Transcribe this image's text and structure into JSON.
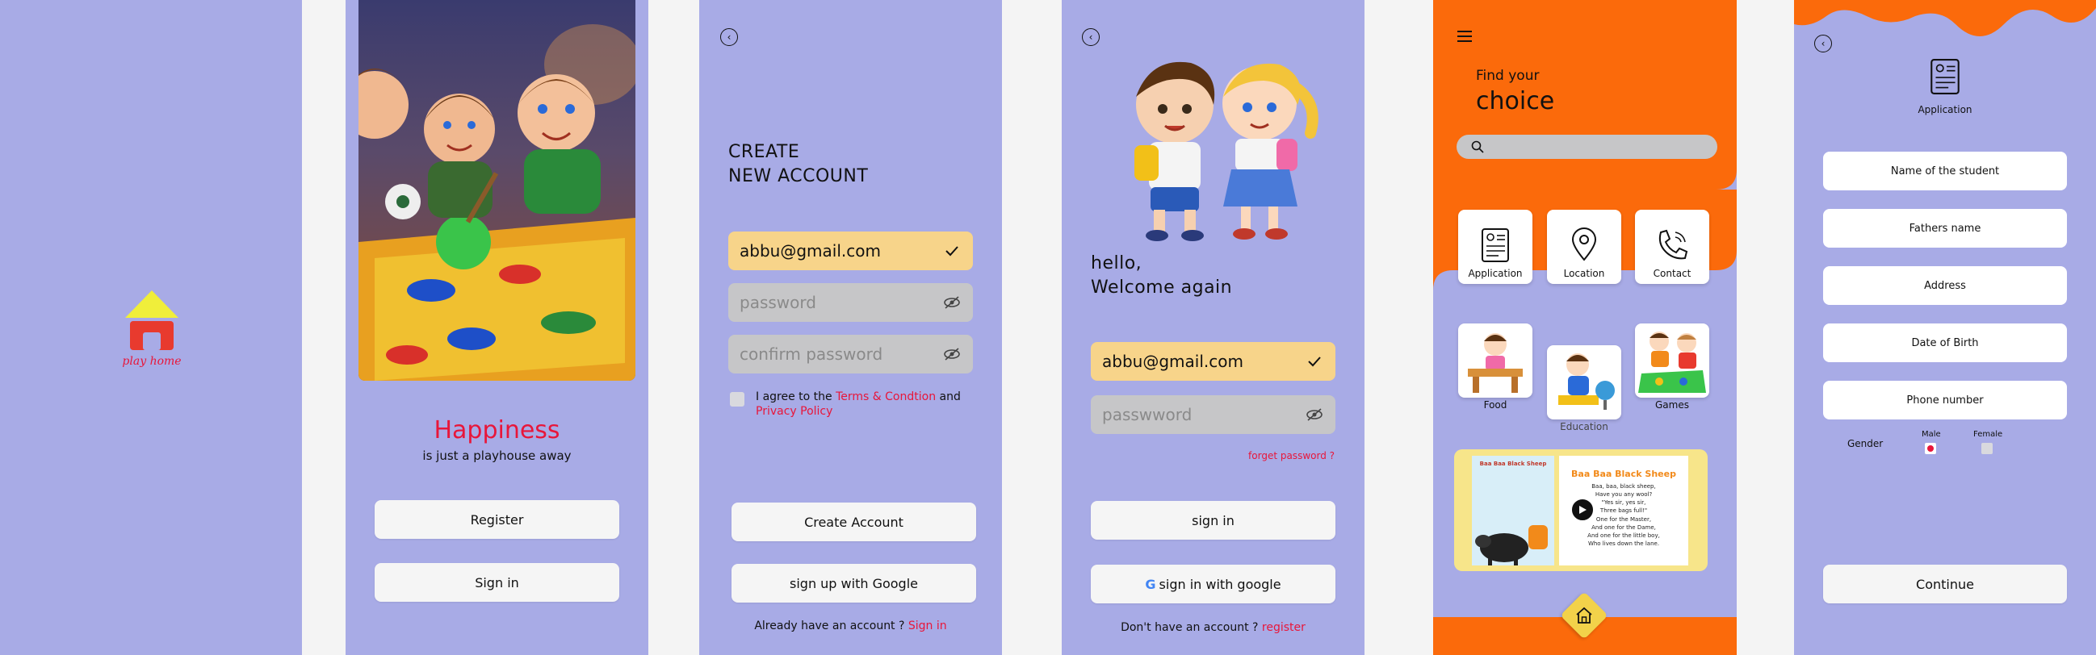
{
  "colors": {
    "lavender": "#a8abe6",
    "orange": "#fb6a0b",
    "yellow": "#f7d48a",
    "red": "#e8163a",
    "gray_field": "#c6c6c8",
    "logo_yellow": "#f0ee3a",
    "logo_red": "#e83a2e"
  },
  "splash": {
    "logo_text": "play home",
    "icon": "house-logo-icon"
  },
  "welcome": {
    "title": "Happiness",
    "subtitle": "is just a playhouse away",
    "register_label": "Register",
    "signin_label": "Sign in",
    "image": "kids-playing-board-game"
  },
  "create_account": {
    "heading_line1": "CREATE",
    "heading_line2": "NEW ACCOUNT",
    "email_value": "abbu@gmail.com",
    "password_placeholder": "password",
    "confirm_placeholder": "confirm password",
    "agree_text": "I agree to the ",
    "terms_link": "Terms & Condtion",
    "and_text": " and",
    "privacy_link": "Privacy Policy",
    "create_button": "Create Account",
    "google_button": "sign up with Google",
    "have_account_text": "Already have an account ? ",
    "signin_link": "Sign in"
  },
  "login": {
    "greeting_line1": "hello,",
    "greeting_line2": "Welcome again",
    "email_value": "abbu@gmail.com",
    "password_placeholder": "passwword",
    "forget_link": "forget password ?",
    "signin_button": "sign in",
    "google_button": "sign in with google",
    "no_account_text": "Don't have an account ? ",
    "register_link": "register",
    "image": "two-kids-with-backpacks"
  },
  "home": {
    "find_text": "Find your",
    "choice_text": "choice",
    "search_placeholder": "",
    "menu_cards": [
      {
        "label": "Application",
        "icon": "application-form-icon"
      },
      {
        "label": "Location",
        "icon": "location-pin-icon"
      },
      {
        "label": "Contact",
        "icon": "phone-icon"
      }
    ],
    "category_cards": [
      {
        "label": "Food"
      },
      {
        "label": "Education"
      },
      {
        "label": "Games"
      }
    ],
    "book": {
      "left_title": "Baa Baa Black Sheep",
      "right_title": "Baa Baa Black Sheep",
      "lines": [
        "Baa, baa, black sheep,",
        "Have you any wool?",
        "\"Yes sir, yes sir,",
        "Three bags full!\"",
        "One for the Master,",
        "And one for the Dame,",
        "And one for the little boy,",
        "Who lives down the lane."
      ]
    }
  },
  "application": {
    "title": "Application",
    "fields": [
      "Name of the student",
      "Fathers name",
      "Address",
      "Date of Birth",
      "Phone number"
    ],
    "gender_label": "Gender",
    "male_label": "Male",
    "female_label": "Female",
    "selected_gender": "Male",
    "continue_button": "Continue"
  }
}
